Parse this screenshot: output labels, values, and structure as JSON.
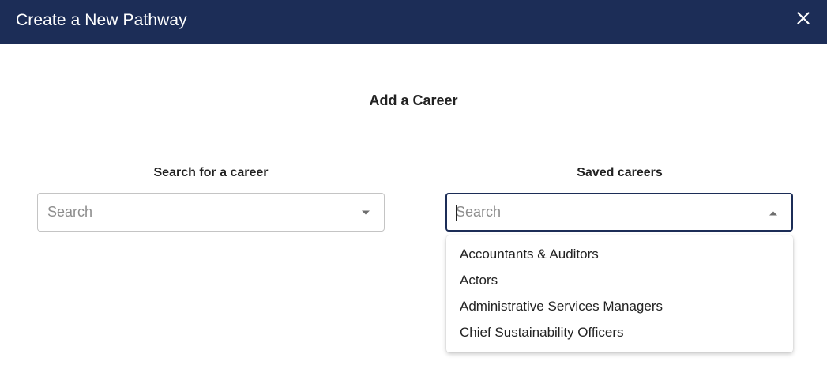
{
  "header": {
    "title": "Create a New Pathway",
    "close_icon": "close-icon",
    "background_color": "#1c2d57"
  },
  "main": {
    "section_title": "Add a Career",
    "search_column": {
      "label": "Search for a career",
      "placeholder": "Search",
      "value": ""
    },
    "saved_column": {
      "label": "Saved careers",
      "placeholder": "Search",
      "value": "",
      "expanded": true,
      "options": [
        "Accountants & Auditors",
        "Actors",
        "Administrative Services Managers",
        "Chief Sustainability Officers"
      ]
    }
  },
  "colors": {
    "accent": "#1c2d57",
    "border": "#c4c4c4",
    "placeholder": "#8e8e8e",
    "text": "#222222"
  }
}
